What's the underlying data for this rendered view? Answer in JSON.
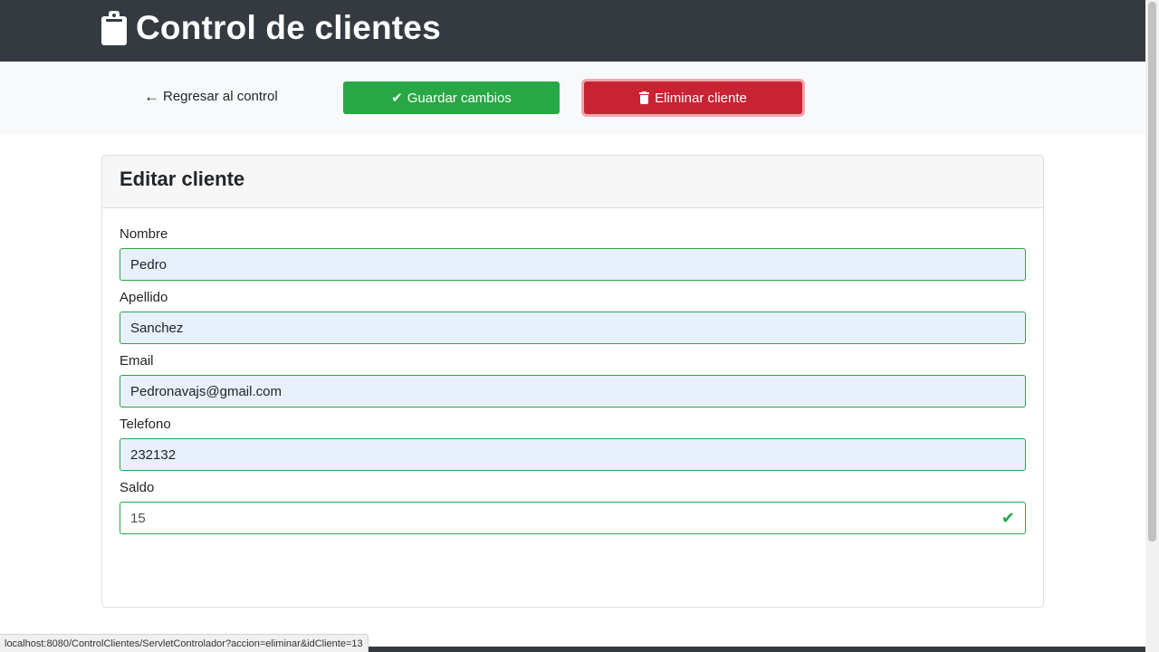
{
  "header": {
    "title": "Control de clientes",
    "icon": "clipboard-icon"
  },
  "actions": {
    "back_label": "Regresar al control",
    "save_label": "Guardar cambios",
    "delete_label": "Eliminar cliente",
    "colors": {
      "save": "#28a745",
      "delete": "#c82333",
      "header": "#343a40"
    }
  },
  "card": {
    "title": "Editar cliente",
    "fields": [
      {
        "label": "Nombre",
        "value": "Pedro"
      },
      {
        "label": "Apellido",
        "value": "Sanchez"
      },
      {
        "label": "Email",
        "value": "Pedronavajs@gmail.com"
      },
      {
        "label": "Telefono",
        "value": "232132"
      },
      {
        "label": "Saldo",
        "value": "15"
      }
    ]
  },
  "status_url": "localhost:8080/ControlClientes/ServletControlador?accion=eliminar&idCliente=13"
}
